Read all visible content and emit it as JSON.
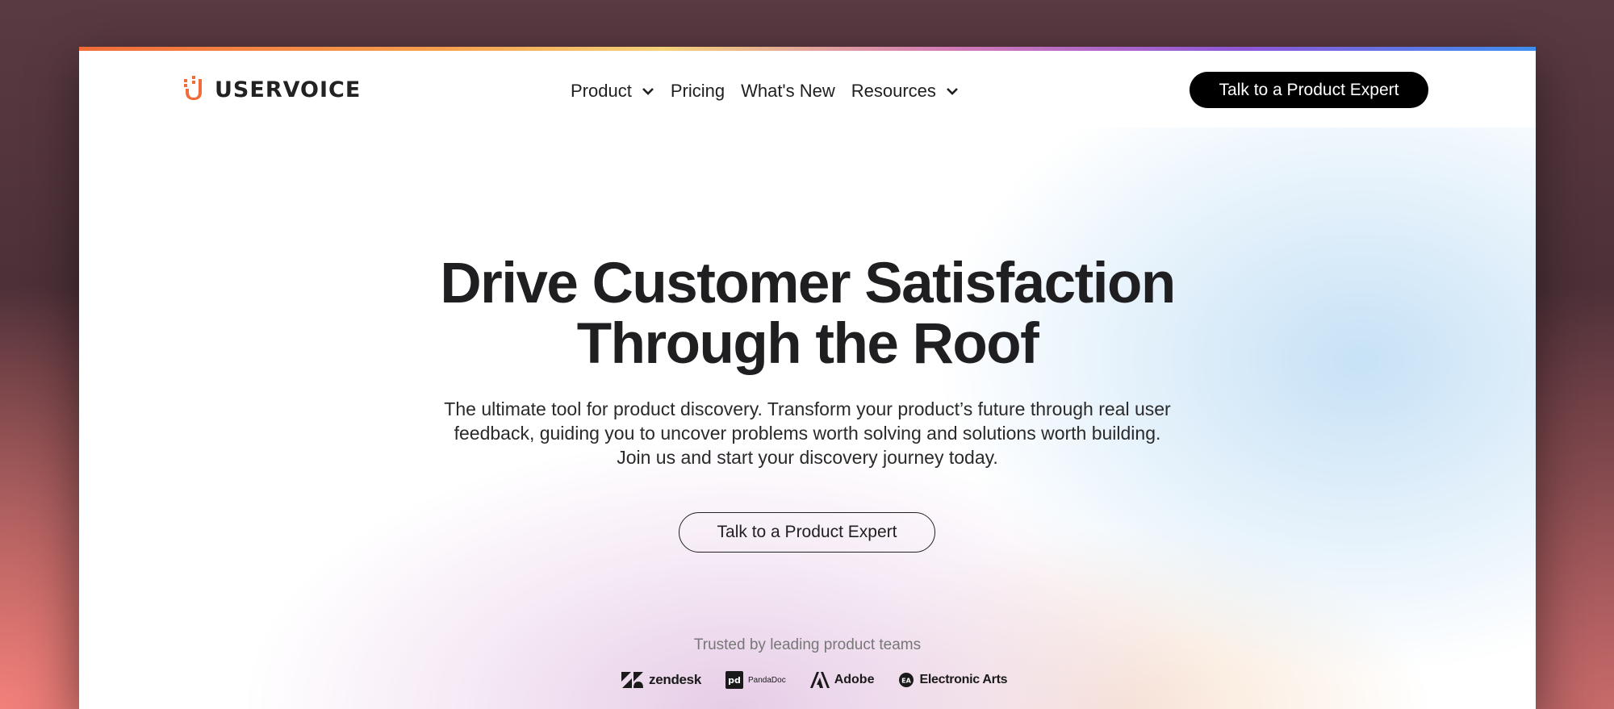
{
  "brand": {
    "name": "USERVOICE"
  },
  "nav": {
    "links": [
      {
        "label": "Product",
        "has_dropdown": true
      },
      {
        "label": "Pricing",
        "has_dropdown": false
      },
      {
        "label": "What's New",
        "has_dropdown": false
      },
      {
        "label": "Resources",
        "has_dropdown": true
      }
    ],
    "cta_label": "Talk to a Product Expert"
  },
  "hero": {
    "headline_line1": "Drive Customer Satisfaction",
    "headline_line2": "Through the Roof",
    "subtext_line1": "The ultimate tool for product discovery. Transform your product’s future through real user",
    "subtext_line2": "feedback, guiding you to uncover problems worth solving and solutions worth building.",
    "subtext_line3": "Join us and start your discovery journey today.",
    "cta_label": "Talk to a Product Expert"
  },
  "trusted": {
    "label": "Trusted by leading product teams",
    "logos": [
      "zendesk",
      "PandaDoc",
      "Adobe",
      "Electronic Arts"
    ]
  },
  "colors": {
    "accent_orange": "#f26b3a",
    "cta_black": "#000000",
    "text_dark": "#1f1f22"
  }
}
